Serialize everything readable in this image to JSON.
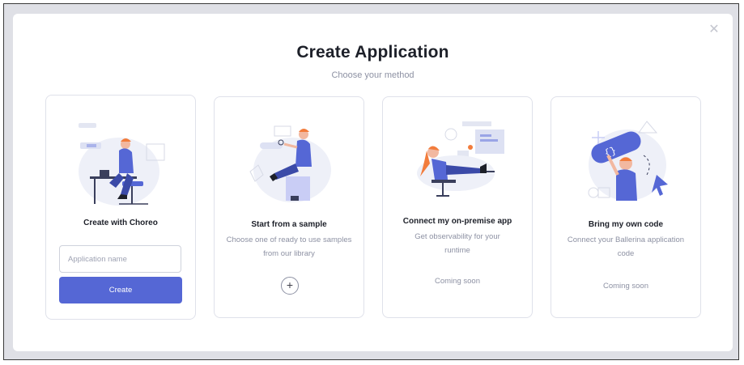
{
  "dialog": {
    "title": "Create Application",
    "subtitle": "Choose your method",
    "close_icon": "close-icon"
  },
  "cards": [
    {
      "title": "Create with Choreo",
      "input_placeholder": "Application name",
      "input_value": "",
      "button_label": "Create"
    },
    {
      "title": "Start from a sample",
      "description": "Choose one of ready to use samples from our library",
      "action_icon": "plus-icon"
    },
    {
      "title": "Connect my on-premise app",
      "description": "Get observability for your runtime",
      "status": "Coming soon"
    },
    {
      "title": "Bring my own code",
      "description": "Connect your Ballerina application code",
      "status": "Coming soon"
    }
  ],
  "colors": {
    "primary": "#5567d5",
    "text": "#1d2029",
    "muted": "#8d91a3",
    "illustration_accent": "#f27c3c"
  }
}
